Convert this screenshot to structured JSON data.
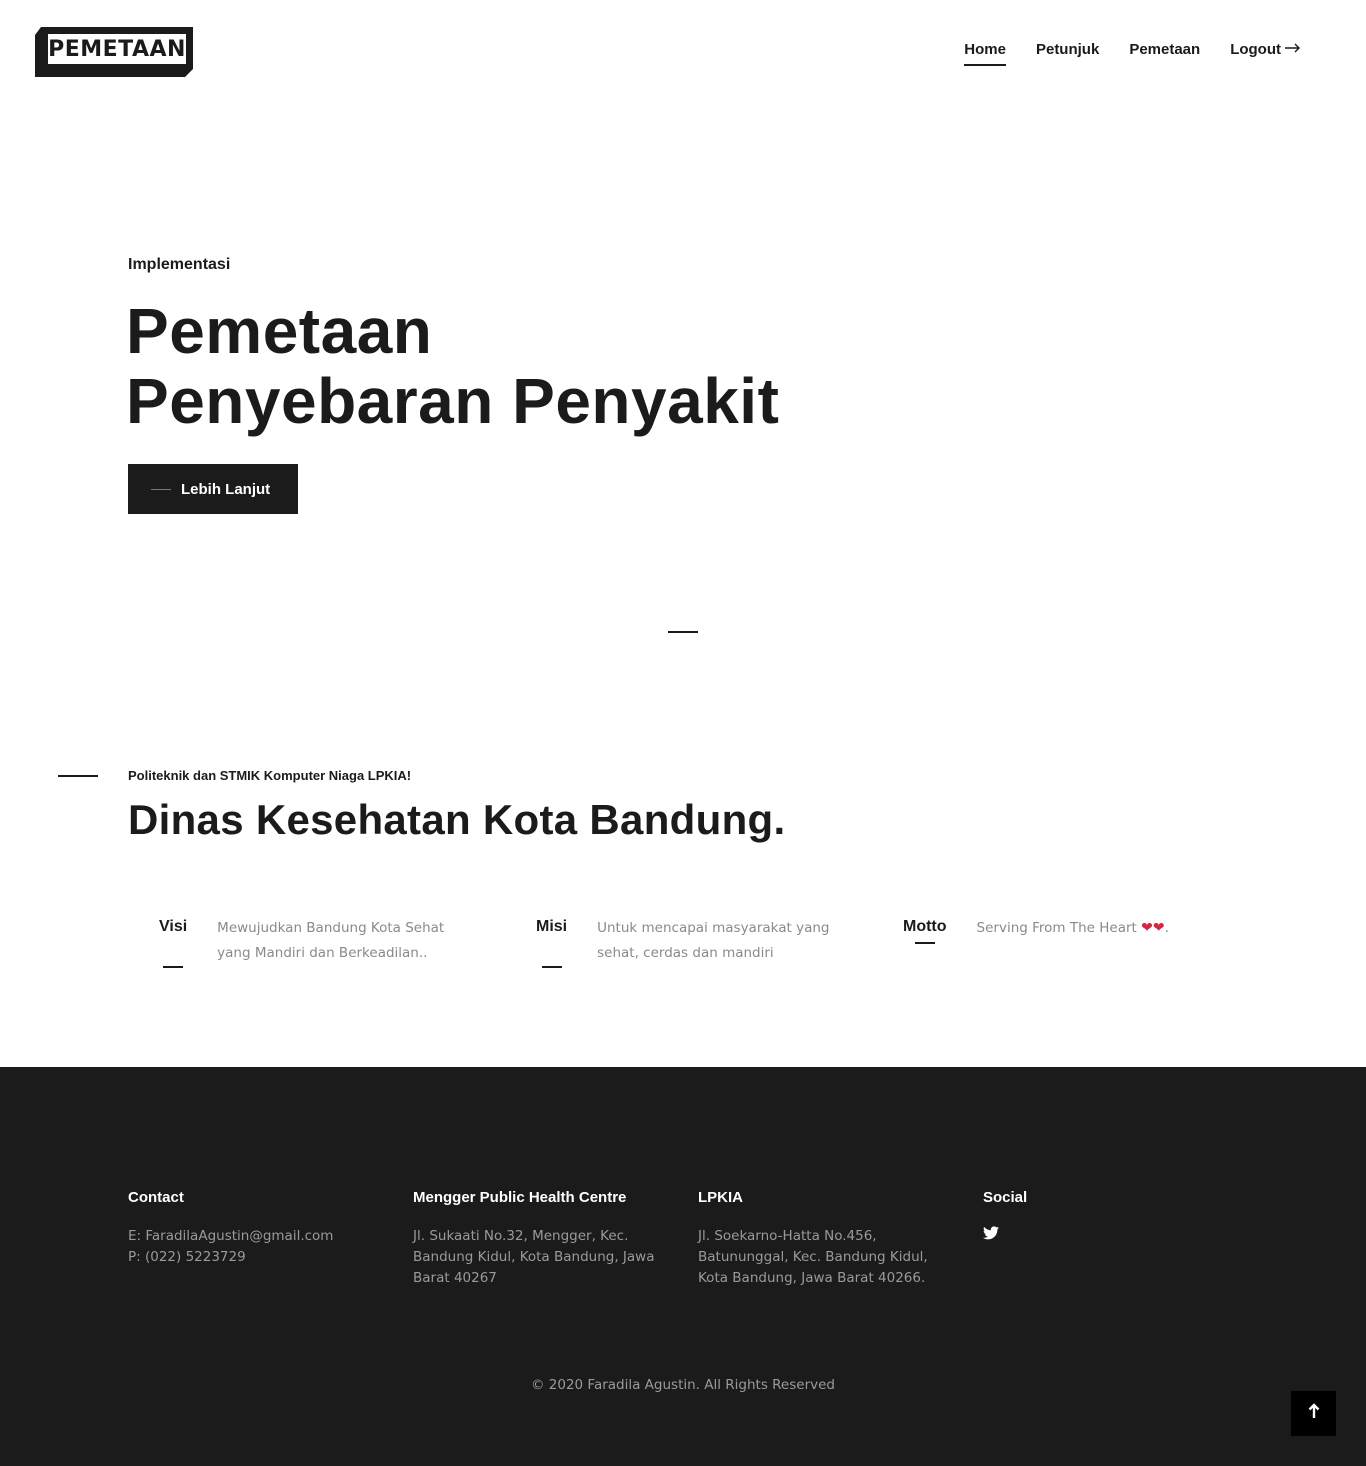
{
  "header": {
    "logo_text": "PEMETAAN",
    "nav": [
      {
        "label": "Home",
        "active": true
      },
      {
        "label": "Petunjuk"
      },
      {
        "label": "Pemetaan"
      },
      {
        "label": "Logout"
      }
    ],
    "logout_icon": "arrow-right-icon"
  },
  "hero": {
    "eyebrow": "Implementasi",
    "title_line1": "Pemetaan",
    "title_line2": "Penyebaran Penyakit",
    "button_label": "Lebih Lanjut"
  },
  "about": {
    "subtitle": "Politeknik dan STMIK Komputer Niaga LPKIA!",
    "title": "Dinas Kesehatan Kota Bandung.",
    "items": [
      {
        "label": "Visi",
        "text": "Mewujudkan Bandung Kota Sehat yang Mandiri dan Berkeadilan.."
      },
      {
        "label": "Misi",
        "text": "Untuk mencapai masyarakat yang sehat, cerdas dan mandiri"
      },
      {
        "label": "Motto",
        "text": "Serving From The Heart",
        "suffix": "."
      }
    ]
  },
  "footer": {
    "contact": {
      "heading": "Contact",
      "email": "E: FaradilaAgustin@gmail.com",
      "phone": "P: (022) 5223729"
    },
    "mengger": {
      "heading": "Mengger Public Health Centre",
      "address": "Jl. Sukaati No.32, Mengger, Kec. Bandung Kidul, Kota Bandung, Jawa Barat 40267"
    },
    "lpkia": {
      "heading": "LPKIA",
      "address": "Jl. Soekarno-Hatta No.456, Batununggal, Kec. Bandung Kidul, Kota Bandung, Jawa Barat 40266."
    },
    "social": {
      "heading": "Social",
      "icon": "twitter-icon"
    },
    "copyright": "© 2020 Faradila Agustin. All Rights Reserved",
    "totop_icon": "arrow-up-icon"
  },
  "colors": {
    "dark": "#1b1b1b",
    "muted": "#8a8a8a",
    "heart": "#d7263d"
  }
}
